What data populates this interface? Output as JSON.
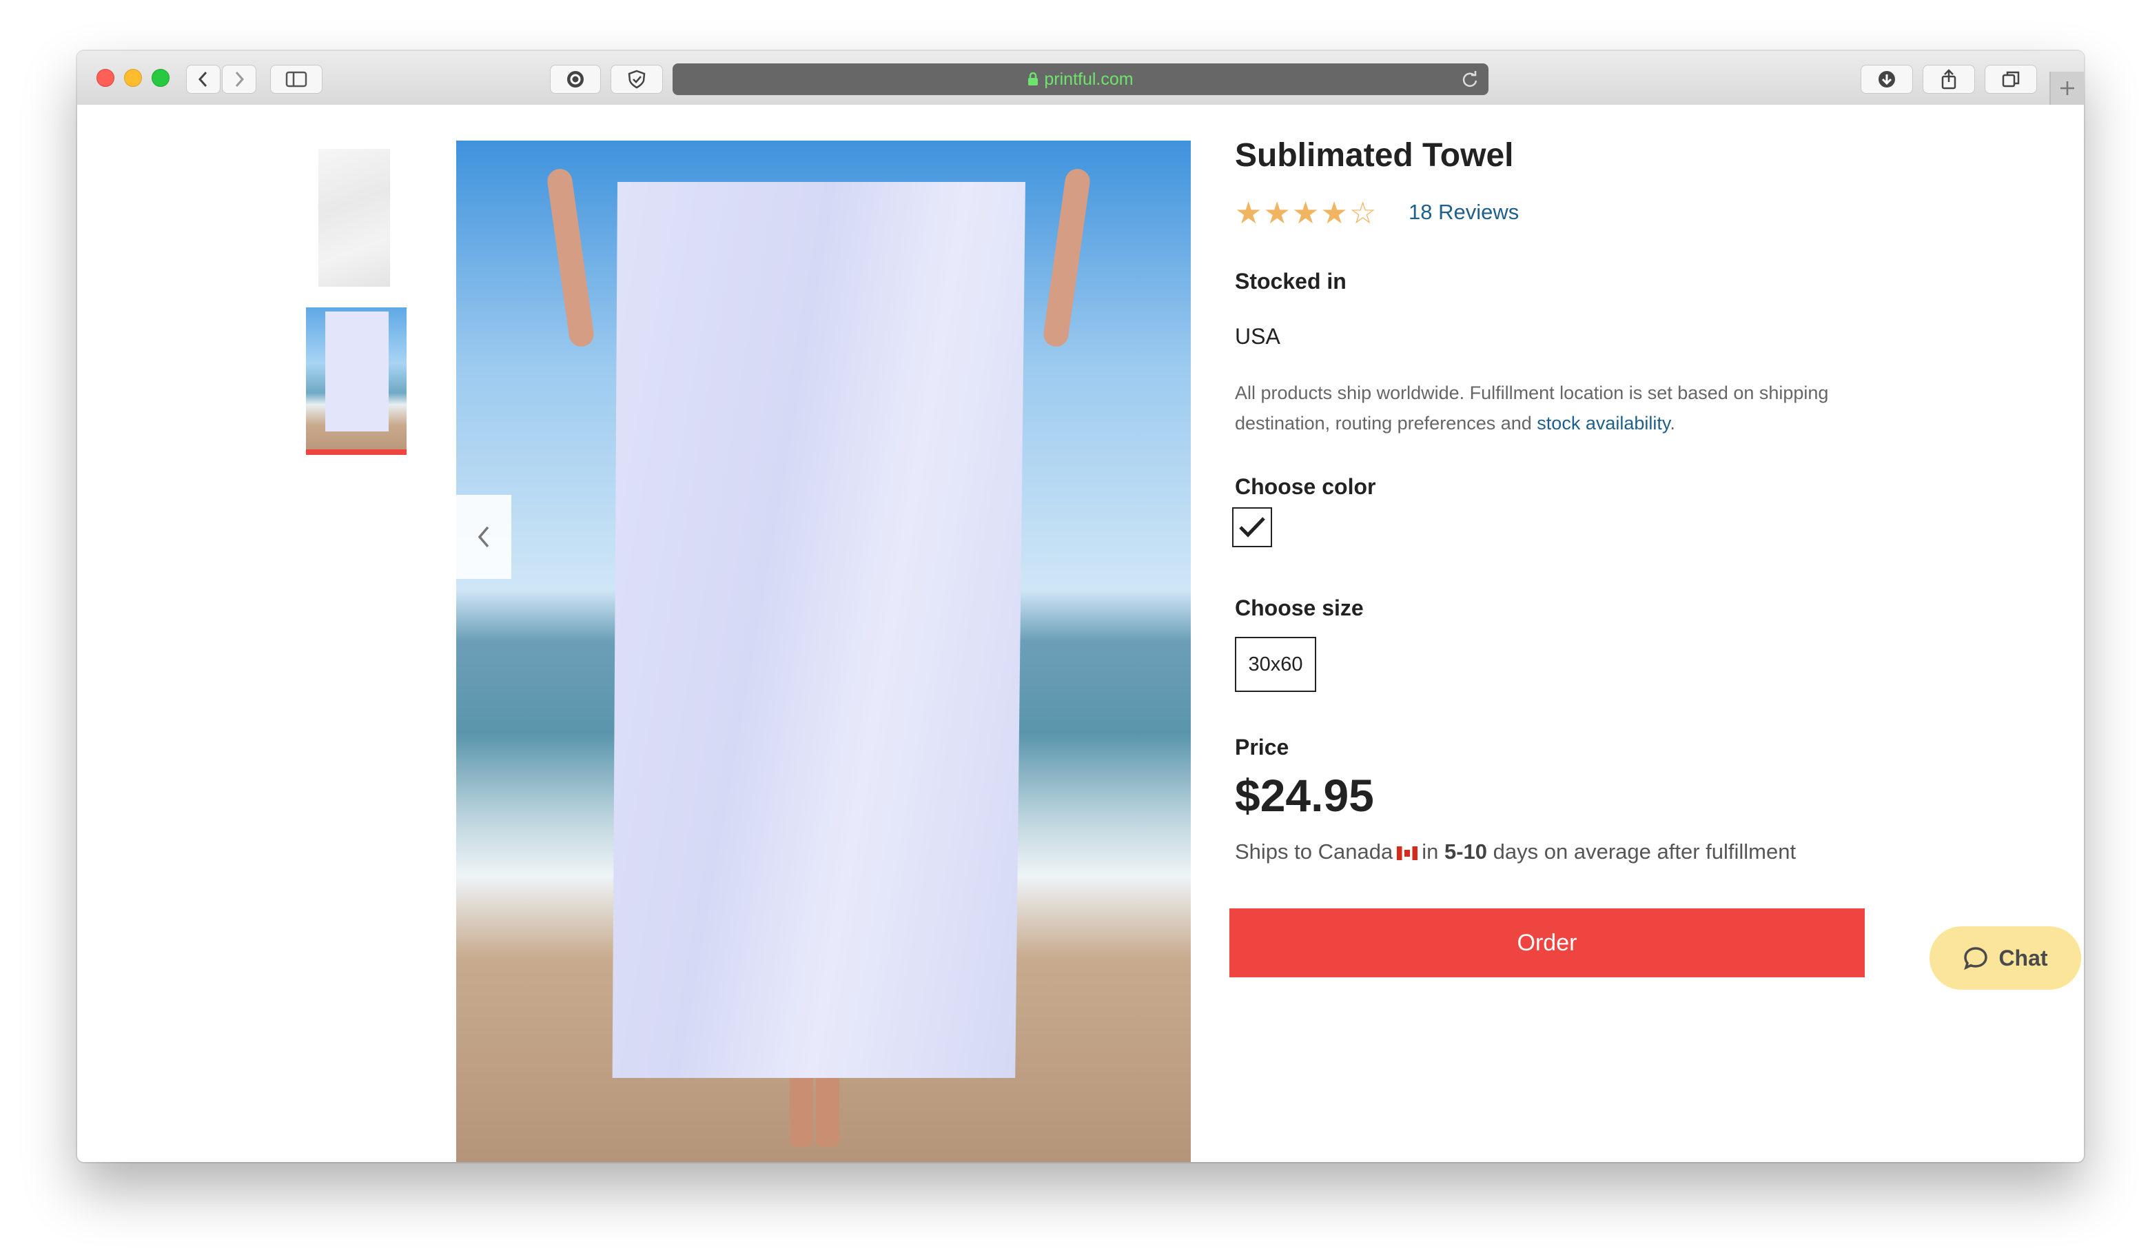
{
  "browser": {
    "url": "printful.com"
  },
  "product": {
    "title": "Sublimated Towel",
    "rating_value": 4,
    "rating_max": 5,
    "reviews_label": "18 Reviews",
    "stocked_in_label": "Stocked in",
    "stocked_in_value": "USA",
    "shipping_note": "All products ship worldwide. Fulfillment location is set based on shipping destination, routing preferences and ",
    "shipping_note_link": "stock availability",
    "shipping_note_end": ".",
    "choose_color_label": "Choose color",
    "choose_size_label": "Choose size",
    "size_option": "30x60",
    "price_label": "Price",
    "price": "$24.95",
    "ships_prefix": "Ships to Canada",
    "ships_in": "in",
    "ships_days": "5-10",
    "ships_suffix": "days on average after fulfillment",
    "order_label": "Order"
  },
  "chat": {
    "label": "Chat"
  },
  "colors": {
    "accent_red": "#ef4540",
    "link_blue": "#1f5f8b",
    "star_gold": "#f1b562",
    "chat_yellow": "#fbe59b"
  }
}
